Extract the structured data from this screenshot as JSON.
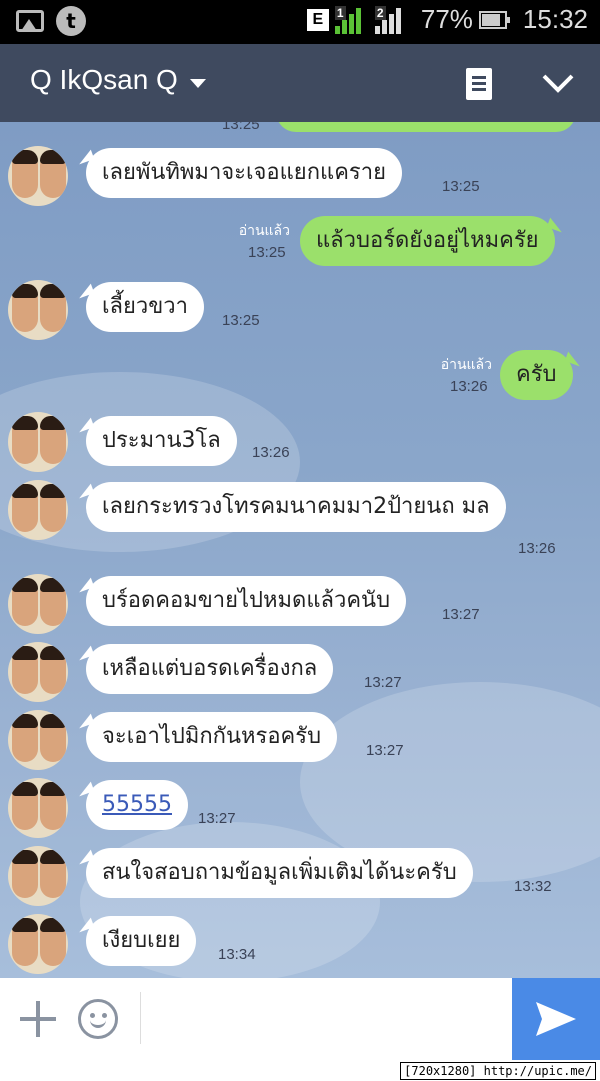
{
  "status_bar": {
    "network_type": "E",
    "sim1_label": "1",
    "sim2_label": "2",
    "battery": "77%",
    "time": "15:32",
    "left_icons": [
      "gallery-icon",
      "t-app-icon"
    ]
  },
  "header": {
    "title": "Q IkQsan Q",
    "icons": [
      "chevron-down-icon",
      "notes-icon"
    ]
  },
  "messages": [
    {
      "side": "in",
      "text": "เลยพันทิพมาจะเจอแยกแคราย",
      "time": "13:25"
    },
    {
      "side": "out",
      "text": "แล้วบอร์ดยังอยู่ไหมครัย",
      "time": "13:25",
      "read": "อ่านแล้ว"
    },
    {
      "side": "in",
      "text": "เลี้ยวขวา",
      "time": "13:25"
    },
    {
      "side": "out",
      "text": "ครับ",
      "time": "13:26",
      "read": "อ่านแล้ว"
    },
    {
      "side": "in",
      "text": "ประมาน3โล",
      "time": "13:26"
    },
    {
      "side": "in",
      "text": "เลยกระทรวงโทรคมนาคมมา2ป้ายนถ มล",
      "time": "13:26"
    },
    {
      "side": "in",
      "text": "บร์อดคอมขายไปหมดแล้วคนับ",
      "time": "13:27"
    },
    {
      "side": "in",
      "text": "เหลือแต่บอรดเครื่องกล",
      "time": "13:27"
    },
    {
      "side": "in",
      "text": "จะเอาไปมิกกันหรอครับ",
      "time": "13:27"
    },
    {
      "side": "in",
      "text": "55555",
      "time": "13:27",
      "is_link": true
    },
    {
      "side": "in",
      "text": "สนใจสอบถามข้อมูลเพิ่มเติมได้นะครับ",
      "time": "13:32"
    },
    {
      "side": "in",
      "text": "เงียบเยย",
      "time": "13:34"
    }
  ],
  "partial_top_time": "13:25",
  "input_bar": {
    "placeholder": "",
    "icons": [
      "plus-icon",
      "emoji-icon",
      "send-icon"
    ]
  },
  "footer": {
    "text": "[720x1280] http://upic.me/"
  },
  "colors": {
    "header_bg": "#3f4a5f",
    "incoming_bubble": "#ffffff",
    "outgoing_bubble": "#9be06b",
    "send_button": "#4a8ae6"
  }
}
